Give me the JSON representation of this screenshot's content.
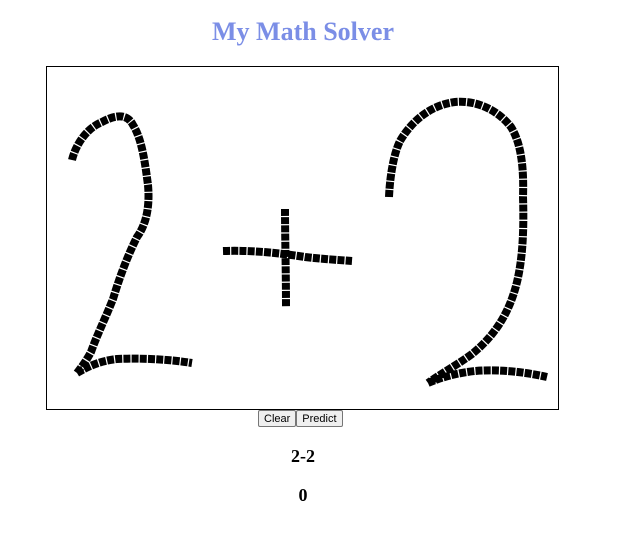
{
  "app": {
    "title": "My Math Solver",
    "title_color": "#7b8ee6"
  },
  "canvas": {
    "ink_color": "#000000",
    "drawn_content": "2+2"
  },
  "controls": {
    "clear_label": "Clear",
    "predict_label": "Predict"
  },
  "results": {
    "expression": "2-2",
    "answer": "0"
  }
}
